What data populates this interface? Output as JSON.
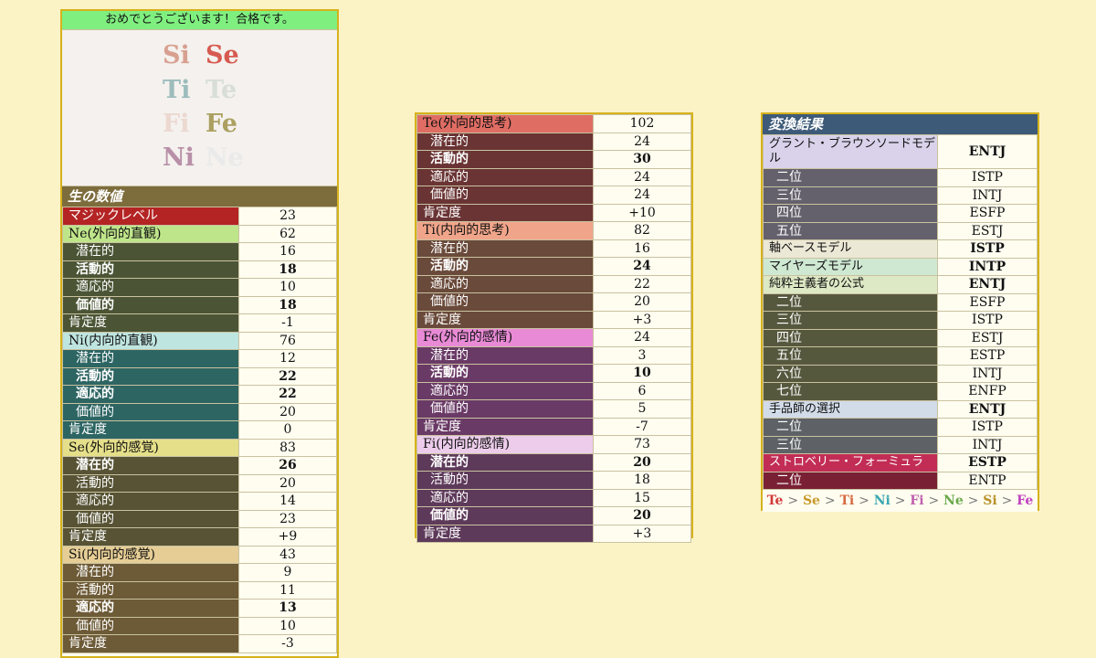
{
  "left": {
    "congrats": "おめでとうございます！合格です。",
    "logo": {
      "items": [
        {
          "text": "Si",
          "color": "#d8a090"
        },
        {
          "text": "Se",
          "color": "#d65a50"
        },
        {
          "text": "Ti",
          "color": "#9dbcbc"
        },
        {
          "text": "Te",
          "color": "#d8ddd8"
        },
        {
          "text": "Fi",
          "color": "#ecd8d0"
        },
        {
          "text": "Fe",
          "color": "#aba060"
        },
        {
          "text": "Ni",
          "color": "#b890a8"
        },
        {
          "text": "Ne",
          "color": "#eaeaea"
        }
      ]
    },
    "section_title": "生の数値",
    "magic": {
      "label": "マジックレベル",
      "value": "23"
    },
    "blocks": [
      {
        "name": "Ne(外向的直観)",
        "value": "62",
        "head_color": "#bfe58a",
        "sub_color": "#4b5535",
        "rows": [
          {
            "label": "潜在的",
            "value": "16",
            "bold": false
          },
          {
            "label": "活動的",
            "value": "18",
            "bold": true
          },
          {
            "label": "適応的",
            "value": "10",
            "bold": false
          },
          {
            "label": "価値的",
            "value": "18",
            "bold": true
          }
        ],
        "aff": {
          "label": "肯定度",
          "value": "-1"
        }
      },
      {
        "name": "Ni(内向的直観)",
        "value": "76",
        "head_color": "#bfe5e0",
        "sub_color": "#2d6563",
        "rows": [
          {
            "label": "潜在的",
            "value": "12",
            "bold": false
          },
          {
            "label": "活動的",
            "value": "22",
            "bold": true
          },
          {
            "label": "適応的",
            "value": "22",
            "bold": true
          },
          {
            "label": "価値的",
            "value": "20",
            "bold": false
          }
        ],
        "aff": {
          "label": "肯定度",
          "value": "0"
        }
      },
      {
        "name": "Se(外向的感覚)",
        "value": "83",
        "head_color": "#e5df8a",
        "sub_color": "#575334",
        "rows": [
          {
            "label": "潜在的",
            "value": "26",
            "bold": true
          },
          {
            "label": "活動的",
            "value": "20",
            "bold": false
          },
          {
            "label": "適応的",
            "value": "14",
            "bold": false
          },
          {
            "label": "価値的",
            "value": "23",
            "bold": false
          }
        ],
        "aff": {
          "label": "肯定度",
          "value": "+9"
        }
      },
      {
        "name": "Si(内向的感覚)",
        "value": "43",
        "head_color": "#e5cd95",
        "sub_color": "#6d5a36",
        "rows": [
          {
            "label": "潜在的",
            "value": "9",
            "bold": false
          },
          {
            "label": "活動的",
            "value": "11",
            "bold": false
          },
          {
            "label": "適応的",
            "value": "13",
            "bold": true
          },
          {
            "label": "価値的",
            "value": "10",
            "bold": false
          }
        ],
        "aff": {
          "label": "肯定度",
          "value": "-3"
        }
      }
    ]
  },
  "mid": {
    "blocks": [
      {
        "name": "Te(外向的思考)",
        "value": "102",
        "head_color": "#e06d64",
        "sub_color": "#6a3434",
        "rows": [
          {
            "label": "潜在的",
            "value": "24",
            "bold": false
          },
          {
            "label": "活動的",
            "value": "30",
            "bold": true
          },
          {
            "label": "適応的",
            "value": "24",
            "bold": false
          },
          {
            "label": "価値的",
            "value": "24",
            "bold": false
          }
        ],
        "aff": {
          "label": "肯定度",
          "value": "+10"
        }
      },
      {
        "name": "Ti(内向的思考)",
        "value": "82",
        "head_color": "#f0a58a",
        "sub_color": "#6a4a3a",
        "rows": [
          {
            "label": "潜在的",
            "value": "16",
            "bold": false
          },
          {
            "label": "活動的",
            "value": "24",
            "bold": true
          },
          {
            "label": "適応的",
            "value": "22",
            "bold": false
          },
          {
            "label": "価値的",
            "value": "20",
            "bold": false
          }
        ],
        "aff": {
          "label": "肯定度",
          "value": "+3"
        }
      },
      {
        "name": "Fe(外向的感情)",
        "value": "24",
        "head_color": "#e88ad6",
        "sub_color": "#6a3a66",
        "rows": [
          {
            "label": "潜在的",
            "value": "3",
            "bold": false
          },
          {
            "label": "活動的",
            "value": "10",
            "bold": true
          },
          {
            "label": "適応的",
            "value": "6",
            "bold": false
          },
          {
            "label": "価値的",
            "value": "5",
            "bold": false
          }
        ],
        "aff": {
          "label": "肯定度",
          "value": "-7"
        }
      },
      {
        "name": "Fi(内向的感情)",
        "value": "73",
        "head_color": "#ecccea",
        "sub_color": "#5e3a5a",
        "rows": [
          {
            "label": "潜在的",
            "value": "20",
            "bold": true
          },
          {
            "label": "活動的",
            "value": "18",
            "bold": false
          },
          {
            "label": "適応的",
            "value": "15",
            "bold": false
          },
          {
            "label": "価値的",
            "value": "20",
            "bold": true
          }
        ],
        "aff": {
          "label": "肯定度",
          "value": "+3"
        }
      }
    ]
  },
  "right": {
    "title": "変換結果",
    "title_color": "#3d5a78",
    "rows": [
      {
        "label": "グラント・ブラウンソードモデル",
        "value": "ENTJ",
        "kind": "head",
        "color": "#d9d2ea",
        "tall": true
      },
      {
        "label": "二位",
        "value": "ISTP",
        "kind": "sub",
        "color": "#64616c"
      },
      {
        "label": "三位",
        "value": "INTJ",
        "kind": "sub",
        "color": "#64616c"
      },
      {
        "label": "四位",
        "value": "ESFP",
        "kind": "sub",
        "color": "#64616c"
      },
      {
        "label": "五位",
        "value": "ESTJ",
        "kind": "sub",
        "color": "#64616c"
      },
      {
        "label": "軸ベースモデル",
        "value": "ISTP",
        "kind": "head",
        "color": "#ece8d6"
      },
      {
        "label": "マイヤーズモデル",
        "value": "INTP",
        "kind": "head",
        "color": "#cfe8d2"
      },
      {
        "label": "純粋主義者の公式",
        "value": "ENTJ",
        "kind": "head",
        "color": "#dde8c4"
      },
      {
        "label": "二位",
        "value": "ESFP",
        "kind": "sub",
        "color": "#56583e"
      },
      {
        "label": "三位",
        "value": "ISTP",
        "kind": "sub",
        "color": "#56583e"
      },
      {
        "label": "四位",
        "value": "ESTJ",
        "kind": "sub",
        "color": "#56583e"
      },
      {
        "label": "五位",
        "value": "ESTP",
        "kind": "sub",
        "color": "#56583e"
      },
      {
        "label": "六位",
        "value": "INTJ",
        "kind": "sub",
        "color": "#56583e"
      },
      {
        "label": "七位",
        "value": "ENFP",
        "kind": "sub",
        "color": "#56583e"
      },
      {
        "label": "手品師の選択",
        "value": "ENTJ",
        "kind": "head",
        "color": "#d2dbe8"
      },
      {
        "label": "二位",
        "value": "ISTP",
        "kind": "sub",
        "color": "#5e6266"
      },
      {
        "label": "三位",
        "value": "INTJ",
        "kind": "sub",
        "color": "#5e6266"
      },
      {
        "label": "ストロベリー・フォーミュラ",
        "value": "ESTP",
        "kind": "head",
        "color": "#c22d55",
        "text_color": "#ffffff"
      },
      {
        "label": "二位",
        "value": "ENTP",
        "kind": "sub",
        "color": "#7a2035"
      }
    ],
    "order": [
      {
        "text": "Te",
        "color": "#d23a3a"
      },
      {
        "text": "Se",
        "color": "#c79a2a"
      },
      {
        "text": "Ti",
        "color": "#d66a40"
      },
      {
        "text": "Ni",
        "color": "#3aa8b0"
      },
      {
        "text": "Fi",
        "color": "#c060b0"
      },
      {
        "text": "Ne",
        "color": "#6aa84a"
      },
      {
        "text": "Si",
        "color": "#b8922a"
      },
      {
        "text": "Fe",
        "color": "#c040c0"
      }
    ],
    "separator": ">"
  }
}
